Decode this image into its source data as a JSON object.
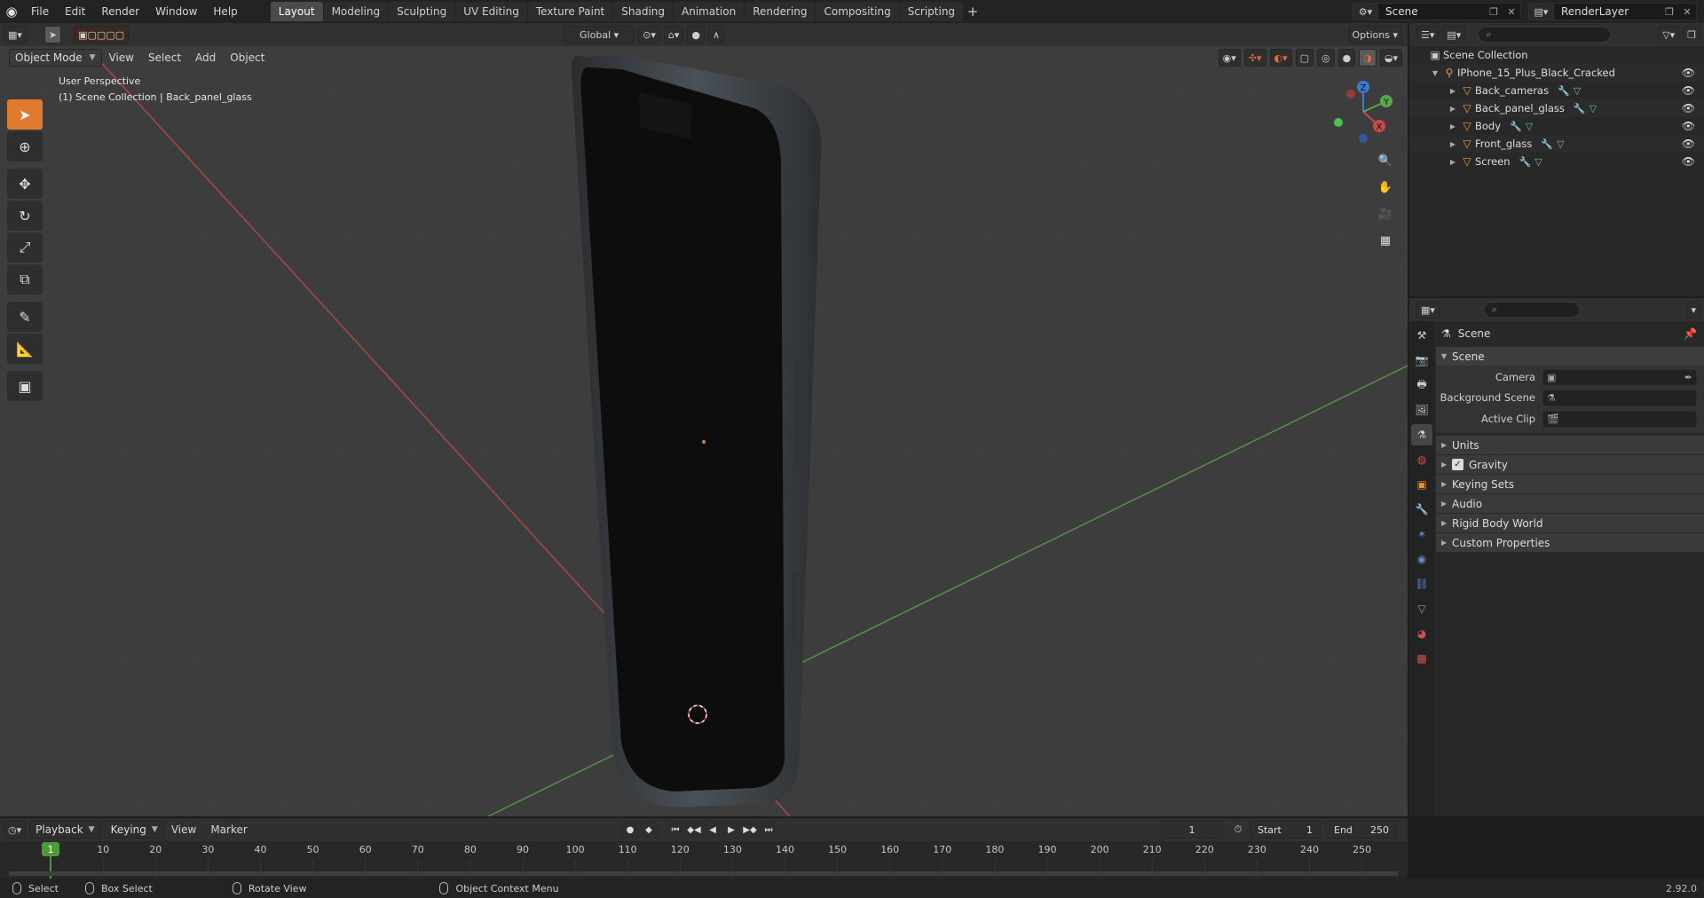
{
  "menubar": {
    "items": [
      "File",
      "Edit",
      "Render",
      "Window",
      "Help"
    ],
    "workspaces": [
      "Layout",
      "Modeling",
      "Sculpting",
      "UV Editing",
      "Texture Paint",
      "Shading",
      "Animation",
      "Rendering",
      "Compositing",
      "Scripting"
    ],
    "active_workspace": "Layout",
    "add_tab": "+",
    "scene_name": "Scene",
    "view_layer": "RenderLayer"
  },
  "viewport": {
    "mode": "Object Mode",
    "menus": [
      "View",
      "Select",
      "Add",
      "Object"
    ],
    "orientation": "Global",
    "options_label": "Options",
    "perspective_label": "User Perspective",
    "context_label": "(1) Scene Collection | Back_panel_glass",
    "gizmo_axes": {
      "x": "X",
      "y": "Y",
      "z": "Z"
    },
    "colors": {
      "background": "#3d3d3d",
      "x_axis": "#c84a4a",
      "y_axis": "#5aa84a",
      "accent": "#e07a2f"
    }
  },
  "outliner": {
    "root": "Scene Collection",
    "collection": "IPhone_15_Plus_Black_Cracked",
    "objects": [
      {
        "name": "Back_cameras"
      },
      {
        "name": "Back_panel_glass"
      },
      {
        "name": "Body"
      },
      {
        "name": "Front_glass"
      },
      {
        "name": "Screen"
      }
    ]
  },
  "properties": {
    "context": "Scene",
    "panel_title": "Scene",
    "fields": [
      {
        "label": "Camera",
        "value": ""
      },
      {
        "label": "Background Scene",
        "value": ""
      },
      {
        "label": "Active Clip",
        "value": ""
      }
    ],
    "sections": [
      {
        "label": "Units",
        "checkbox": false
      },
      {
        "label": "Gravity",
        "checkbox": true
      },
      {
        "label": "Keying Sets",
        "checkbox": false
      },
      {
        "label": "Audio",
        "checkbox": false
      },
      {
        "label": "Rigid Body World",
        "checkbox": false
      },
      {
        "label": "Custom Properties",
        "checkbox": false
      }
    ]
  },
  "timeline": {
    "menus": [
      "Playback",
      "Keying",
      "View",
      "Marker"
    ],
    "current_frame": "1",
    "start_label": "Start",
    "start": "1",
    "end_label": "End",
    "end": "250",
    "ruler_labels": [
      "1",
      "10",
      "20",
      "30",
      "40",
      "50",
      "60",
      "70",
      "80",
      "90",
      "100",
      "110",
      "120",
      "130",
      "140",
      "150",
      "160",
      "170",
      "180",
      "190",
      "200",
      "210",
      "220",
      "230",
      "240",
      "250"
    ]
  },
  "statusbar": {
    "items": [
      "Select",
      "Box Select",
      "Rotate View",
      "Object Context Menu"
    ],
    "version": "2.92.0"
  }
}
